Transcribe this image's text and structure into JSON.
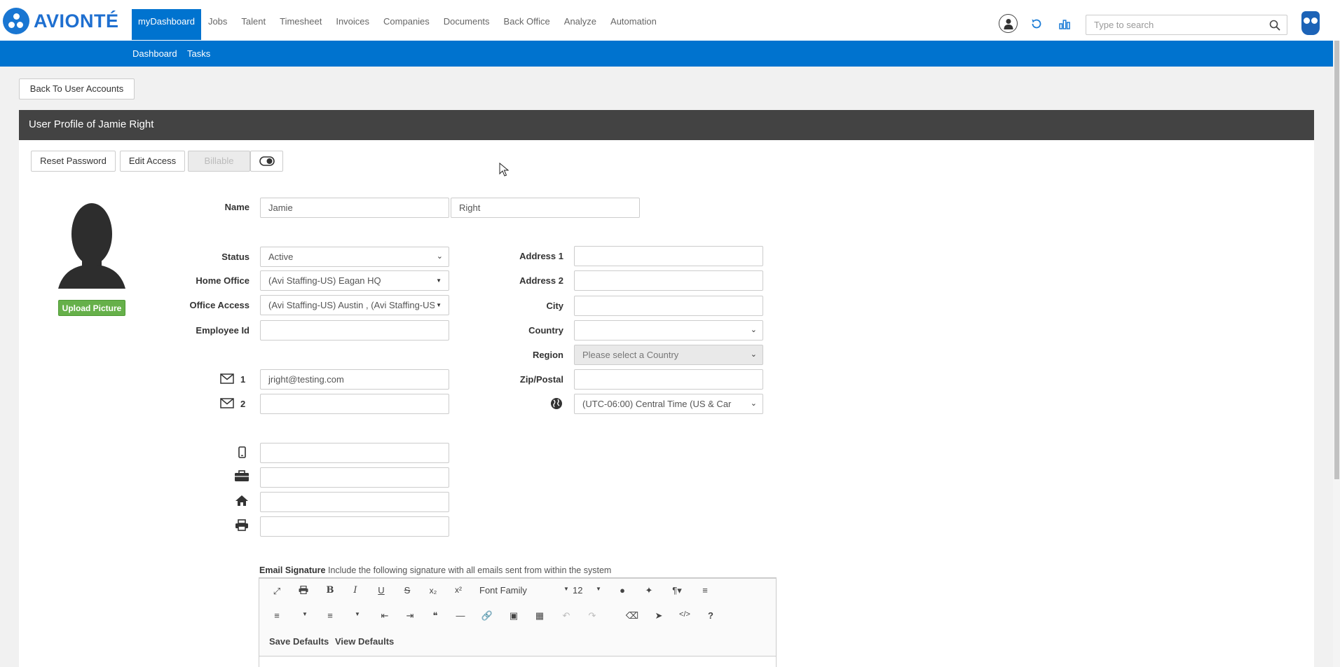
{
  "brand": {
    "name": "AVIONTÉ"
  },
  "nav": {
    "items": [
      "myDashboard",
      "Jobs",
      "Talent",
      "Timesheet",
      "Invoices",
      "Companies",
      "Documents",
      "Back Office",
      "Analyze",
      "Automation"
    ],
    "active": "myDashboard"
  },
  "header_icons": [
    "user-icon",
    "refresh-icon",
    "analytics-icon"
  ],
  "search": {
    "placeholder": "Type to search",
    "value": ""
  },
  "subnav": {
    "items": [
      "Dashboard",
      "Tasks"
    ]
  },
  "back_button": "Back To User Accounts",
  "panel": {
    "title": "User Profile of Jamie Right"
  },
  "actions": {
    "reset_password": "Reset Password",
    "edit_access": "Edit Access",
    "billable": "Billable"
  },
  "upload_picture": "Upload Picture",
  "form": {
    "labels": {
      "name": "Name",
      "status": "Status",
      "home_office": "Home Office",
      "office_access": "Office Access",
      "employee_id": "Employee Id",
      "address1": "Address 1",
      "address2": "Address 2",
      "city": "City",
      "country": "Country",
      "region": "Region",
      "zip": "Zip/Postal",
      "email1": "1",
      "email2": "2"
    },
    "first_name": "Jamie",
    "last_name": "Right",
    "status": "Active",
    "home_office": "(Avi Staffing-US) Eagan HQ",
    "office_access": "(Avi Staffing-US) Austin , (Avi Staffing-US",
    "employee_id": "",
    "email1": "jright@testing.com",
    "email2": "",
    "address1": "",
    "address2": "",
    "city": "",
    "country": "",
    "region": "Please select a Country",
    "zip": "",
    "timezone": "(UTC-06:00) Central Time (US & Car",
    "mobile": "",
    "work": "",
    "home": "",
    "fax": ""
  },
  "signature": {
    "label": "Email Signature",
    "help": "Include the following signature with all emails sent from within the system",
    "font_family": "Font Family",
    "font_size": "12",
    "save_defaults": "Save Defaults",
    "view_defaults": "View Defaults"
  },
  "colors": {
    "primary": "#0073cf",
    "header": "#434343",
    "upload": "#66b04a"
  }
}
